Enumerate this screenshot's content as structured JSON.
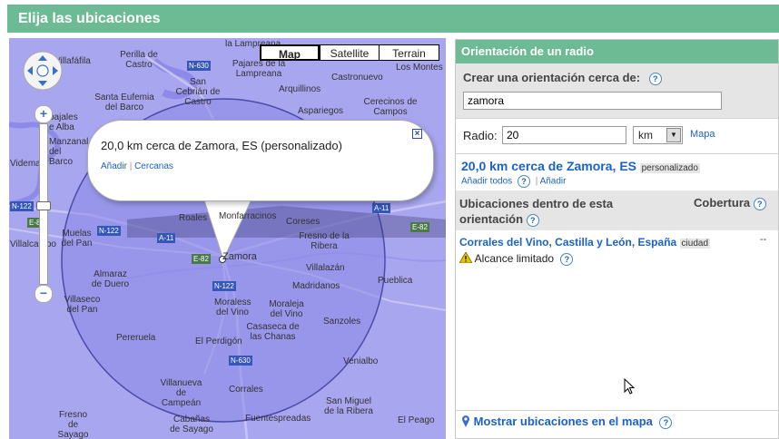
{
  "header": {
    "title": "Elija las ubicaciones"
  },
  "map": {
    "type_buttons": [
      "Map",
      "Satellite",
      "Terrain"
    ],
    "selected_type": "Map",
    "labels": [
      "la Lampreana",
      "Perilla de Castro",
      "N-630",
      "Pajares de la Lampreana",
      "Castronuevo",
      "Los Montes",
      "Villafáfila",
      "San Cebrián de Castro",
      "Arquillinos",
      "Santa Eufemia del Barco",
      "Cerecinos de Campos",
      "Aspariegos",
      "bajales e Alba",
      "Manzanal del Barco",
      "Videmal",
      "N-122",
      "E-82",
      "Roales",
      "Monfarracinos",
      "Coreses",
      "Muelas del Pan",
      "N-122",
      "A-11",
      "Fresno de la Ribera",
      "E-82",
      "Zamora",
      "Villalazán",
      "Almaraz de Duero",
      "N-122",
      "Madridanos",
      "Pueblica",
      "Villaseco del Pan",
      "Moraless del Vino",
      "Moraleja del Vino",
      "Casaseca de las Chanas",
      "Sanzoles",
      "Pereruela",
      "El Perdigón",
      "N-630",
      "Venialbo",
      "Villanueva de Campeán",
      "Corrales",
      "San Miguel de la Ribera",
      "Fresno de Sayago",
      "Cabañas de Sayago",
      "Fuentespreadas",
      "El Peago",
      "A-11",
      "E-82",
      "Villalcampo"
    ],
    "bubble": {
      "title": "20,0 km cerca de Zamora, ES (personalizado)",
      "add_link": "Añadir",
      "separator": "|",
      "nearby_link": "Cercanas",
      "close_icon": "close-icon"
    },
    "zoom": {
      "in": "+",
      "out": "−"
    }
  },
  "panel": {
    "header": "Orientación de un radio",
    "create_label": "Crear una orientación cerca de:",
    "search_value": "zamora",
    "radius_label": "Radio:",
    "radius_value": "20",
    "unit_value": "km",
    "map_link": "Mapa",
    "result_title": "20,0 km cerca de Zamora, ES",
    "result_tag": "personalizado",
    "add_all": "Añadir todos",
    "add": "Añadir",
    "separator": "|",
    "locations_header": "Ubicaciones dentro de esta orientación",
    "coverage_header": "Cobertura",
    "location_name": "Corrales del Vino, Castilla y León, España",
    "location_tag": "ciudad",
    "location_coverage": "--",
    "reach_text": "Alcance limitado",
    "show_map": "Mostrar ubicaciones en el mapa"
  },
  "colors": {
    "header_bg": "#6dbb94",
    "link": "#1a62c8",
    "map_bg": "#a9a6f0",
    "circle": "#8a88e6"
  }
}
